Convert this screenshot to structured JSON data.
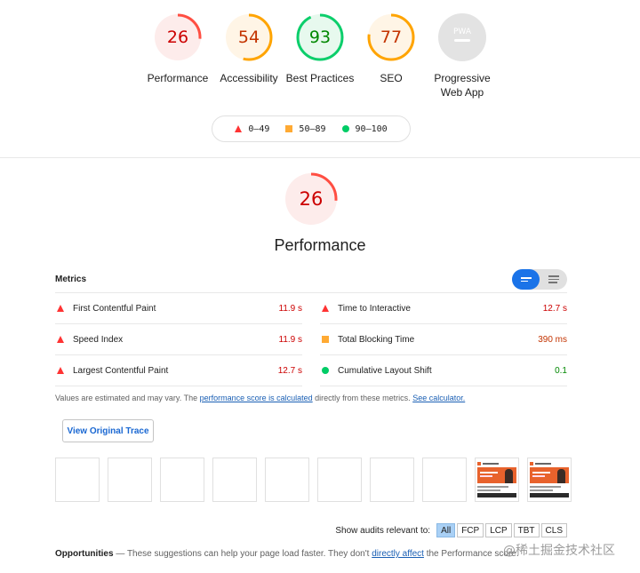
{
  "categories": [
    {
      "name": "performance",
      "score": "26",
      "label": "Performance",
      "color": "#ff4e42",
      "bg": "#fdeceb",
      "text": "#c00",
      "fraction": 0.26
    },
    {
      "name": "accessibility",
      "score": "54",
      "label": "Accessibility",
      "color": "#ffa400",
      "bg": "#fff5e6",
      "text": "#c33300",
      "fraction": 0.54
    },
    {
      "name": "best-practices",
      "score": "93",
      "label": "Best Practices",
      "color": "#0cce6b",
      "bg": "#e7f9ee",
      "text": "#080",
      "fraction": 0.93
    },
    {
      "name": "seo",
      "score": "77",
      "label": "SEO",
      "color": "#ffa400",
      "bg": "#fff5e6",
      "text": "#c33300",
      "fraction": 0.77
    },
    {
      "name": "pwa",
      "score": "PWA",
      "label": "Progressive Web App",
      "color": "#bdbdbd",
      "bg": "#e3e3e3",
      "text": "#ffffff",
      "fraction": 0
    }
  ],
  "legend": {
    "fail": "0–49",
    "average": "50–89",
    "pass": "90–100"
  },
  "performance": {
    "score": "26",
    "title": "Performance",
    "fraction": 0.26
  },
  "metrics": {
    "title": "Metrics",
    "items": [
      {
        "label": "First Contentful Paint",
        "value": "11.9 s",
        "status": "fail"
      },
      {
        "label": "Time to Interactive",
        "value": "12.7 s",
        "status": "fail"
      },
      {
        "label": "Speed Index",
        "value": "11.9 s",
        "status": "fail"
      },
      {
        "label": "Total Blocking Time",
        "value": "390 ms",
        "status": "average"
      },
      {
        "label": "Largest Contentful Paint",
        "value": "12.7 s",
        "status": "fail"
      },
      {
        "label": "Cumulative Layout Shift",
        "value": "0.1",
        "status": "pass"
      }
    ]
  },
  "note": {
    "prefix": "Values are estimated and may vary. The ",
    "link1": "performance score is calculated",
    "middle": " directly from these metrics. ",
    "link2": "See calculator."
  },
  "trace_button": "View Original Trace",
  "filmstrip": {
    "empty_frames": 8,
    "loaded_frames": 2
  },
  "filter": {
    "label": "Show audits relevant to:",
    "chips": [
      "All",
      "FCP",
      "LCP",
      "TBT",
      "CLS"
    ],
    "active": "All"
  },
  "opportunities": {
    "title": "Opportunities",
    "dash": " — ",
    "text": "These suggestions can help your page load faster. They don't ",
    "link": "directly affect",
    "suffix": " the Performance score."
  },
  "watermark": "@稀土掘金技术社区"
}
